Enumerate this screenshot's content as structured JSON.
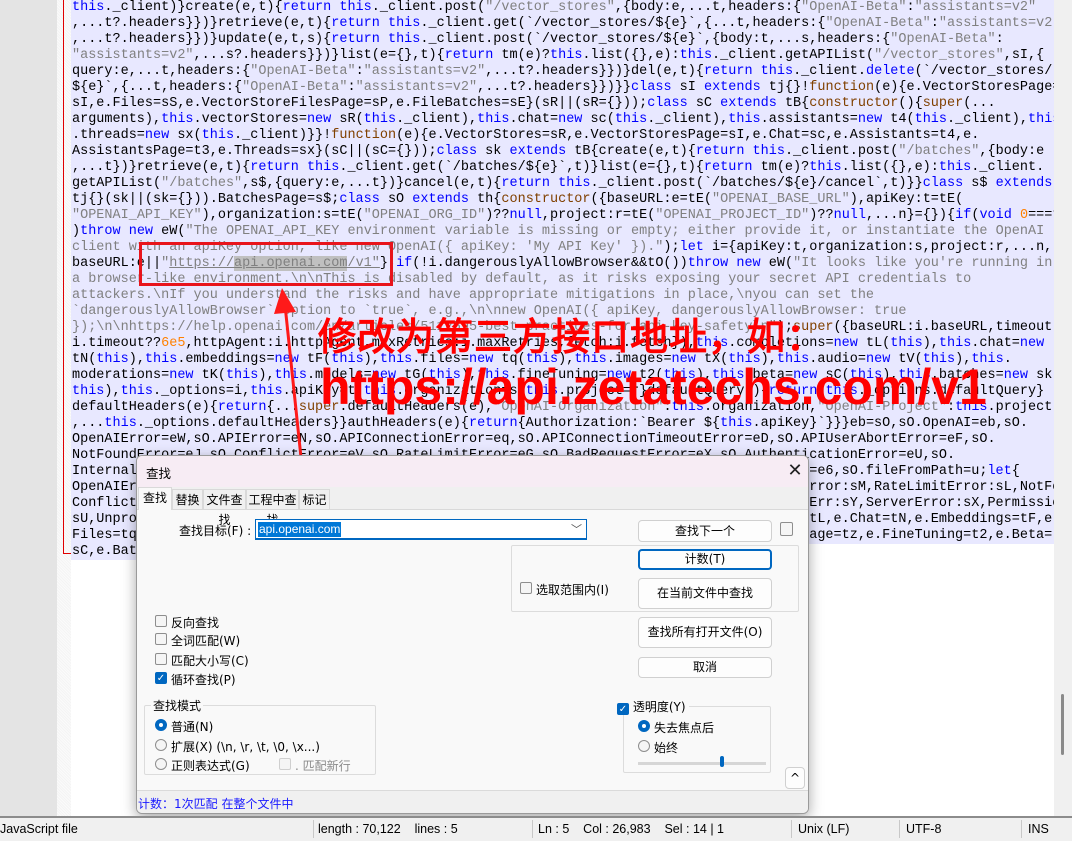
{
  "editor": {
    "lines": [
      "this._client)}create(e,t){return this._client.post(\"/vector_stores\",{body:e,...t,headers:{\"OpenAI-Beta\":\"assistants=v2\"",
      ",...t?.headers}})}retrieve(e,t){return this._client.get(`/vector_stores/${e}`,{...t,headers:{\"OpenAI-Beta\":\"assistants=v2\"",
      ",...t?.headers}})}update(e,t,s){return this._client.post(`/vector_stores/${e}`,{body:t,...s,headers:{\"OpenAI-Beta\":",
      "\"assistants=v2\",...s?.headers}})}list(e={},t){return tm(e)?this.list({},e):this._client.getAPIList(\"/vector_stores\",sI,{",
      "query:e,...t,headers:{\"OpenAI-Beta\":\"assistants=v2\",...t?.headers}})}del(e,t){return this._client.delete(`/vector_stores/",
      "${e}`,{...t,headers:{\"OpenAI-Beta\":\"assistants=v2\",...t?.headers}})}}class sI extends tj{}!function(e){e.VectorStoresPage=",
      "sI,e.Files=sS,e.VectorStoreFilesPage=sP,e.FileBatches=sE}(sR||(sR={}));class sC extends tB{constructor(){super(...",
      "arguments),this.vectorStores=new sR(this._client),this.chat=new sc(this._client),this.assistants=new t4(this._client),this",
      ".threads=new sx(this._client)}}!function(e){e.VectorStores=sR,e.VectorStoresPage=sI,e.Chat=sc,e.Assistants=t4,e.",
      "AssistantsPage=t3,e.Threads=sx}(sC||(sC={}));class sk extends tB{create(e,t){return this._client.post(\"/batches\",{body:e",
      ",...t})}retrieve(e,t){return this._client.get(`/batches/${e}`,t)}list(e={},t){return tm(e)?this.list({},e):this._client.",
      "getAPIList(\"/batches\",s$,{query:e,...t})}cancel(e,t){return this._client.post(`/batches/${e}/cancel`,t)}}class s$ extends",
      "tj{}(sk||(sk={})).BatchesPage=s$;class sO extends th{constructor({baseURL:e=tE(\"OPENAI_BASE_URL\"),apiKey:t=tE(",
      "\"OPENAI_API_KEY\"),organization:s=tE(\"OPENAI_ORG_ID\")??null,project:r=tE(\"OPENAI_PROJECT_ID\")??null,...n}={}){if(void 0===t",
      ")throw new eW(\"The OPENAI_API_KEY environment variable is missing or empty; either provide it, or instantiate the OpenAI",
      "client with an apiKey option, like new OpenAI({ apiKey: 'My API Key' }).\");let i={apiKey:t,organization:s,project:r,...n,",
      "baseURL:e||\"https://api.openai.com/v1\"};if(!i.dangerouslyAllowBrowser&&tO())throw new eW(\"It looks like you're running in",
      "a browser-like environment.\\n\\nThis is disabled by default, as it risks exposing your secret API credentials to",
      "attackers.\\nIf you understand the risks and have appropriate mitigations in place,\\nyou can set the",
      "`dangerouslyAllowBrowser` option to `true`, e.g.,\\n\\nnew OpenAI({ apiKey, dangerouslyAllowBrowser: true",
      "});\\n\\nhttps://help.openai.com/en/articles/5112595-best-practices-for-api-key-safety\\n\");super({baseURL:i.baseURL,timeout:",
      "i.timeout??6e5,httpAgent:i.httpAgent,maxRetries:i.maxRetries,fetch:i.fetch}),this.completions=new tL(this),this.chat=new",
      "tN(this),this.embeddings=new tF(this),this.files=new tq(this),this.images=new tX(this),this.audio=new tV(this),this.",
      "moderations=new tK(this),this.models=new tG(this),this.fineTuning=new t2(this),this.beta=new sC(this),this.batches=new sk(",
      "this),this._options=i,this.apiKey=t,this.organization=s,this.project=r}defaultQuery(){return this._options.defaultQuery}",
      "defaultHeaders(e){return{...super.defaultHeaders(e),\"OpenAI-Organization\":this.organization,\"OpenAI-Project\":this.project",
      ",...this._options.defaultHeaders}}authHeaders(e){return{Authorization:`Bearer ${this.apiKey}`}}}eb=sO,sO.OpenAI=eb,sO.",
      "OpenAIError=eW,sO.APIError=eN,sO.APIConnectionError=eq,sO.APIConnectionTimeoutError=eD,sO.APIUserAbortError=eF,sO.",
      "NotFoundError=eJ,sO.ConflictError=eV,sO.RateLimitError=eG,sO.BadRequestError=eX,sO.AuthenticationError=eU,sO.",
      "InternalServerError=e0,sO.PermissionDeniedError=eK,sO.UnprocessableEntityError=eZ,sO.toFile=e6,sO.fileFromPath=u;let{",
      "OpenAIError:sN,APIError:sA,APIConnectionError:sT,APIConnectionTimeoutError:sj,APIUserAbortError:sM,RateLimitError:sL,NotFoundError:sW,",
      "ConflictError:sD,InternalServerError:sq,AuthenticationError:sF,BadRequestError:sB,RateLimitErr:sY,ServerError:sX,PermissionDeniedError:",
      "sU,UnprocessableEntityError:sZ}=sO;!function(e){e.toFile=e6,e.fileFromPath=u,e.Completions=tL,e.Chat=tN,e.Embeddings=tF,e.",
      "Files=tq,e.FileObjectsPage=tI,e.Images=tX,e.Audio=tV,e.Moderations=tK,e.Models=tG,e.ModelsPage=tz,e.FineTuning=t2,e.Beta=",
      "sC,e.Batches=sk"
    ],
    "search_hit": "api.openai.com",
    "colors": {
      "keyword": "#0000ff",
      "string": "#808080",
      "number": "#ff8000",
      "selection": "#e8e8ff",
      "hit": "#c0c0c0"
    }
  },
  "annotation": {
    "text_line1": "修改为第三方接口地址，如：",
    "text_line2": "https://api.zetatechs.com/v1",
    "color": "#ff0000"
  },
  "find_dialog": {
    "title": "查找",
    "close_icon": "close-icon",
    "tabs": [
      {
        "label": "查找",
        "active": true
      },
      {
        "label": "替换",
        "active": false
      },
      {
        "label": "文件查找",
        "active": false
      },
      {
        "label": "工程中查找",
        "active": false
      },
      {
        "label": "标记",
        "active": false
      }
    ],
    "find_label": "查找目标(F) :",
    "find_value": "api.openai.com",
    "buttons": {
      "find_next": "查找下一个",
      "count": "计数(T)",
      "find_in_current": "在当前文件中查找",
      "find_in_all_open": "查找所有打开文件(O)",
      "cancel": "取消",
      "collapse": "^"
    },
    "in_selection": {
      "label": "选取范围内(I)",
      "checked": false
    },
    "options": [
      {
        "label": "反向查找",
        "checked": false
      },
      {
        "label": "全词匹配(W)",
        "checked": false
      },
      {
        "label": "匹配大小写(C)",
        "checked": false
      },
      {
        "label": "循环查找(P)",
        "checked": true
      }
    ],
    "search_mode": {
      "legend": "查找模式",
      "options": [
        {
          "label": "普通(N)",
          "selected": true
        },
        {
          "label": "扩展(X) (\\n, \\r, \\t, \\0, \\x...)",
          "selected": false
        },
        {
          "label": "正则表达式(G)",
          "selected": false
        }
      ],
      "dot_matches_newline": {
        "label": ". 匹配新行",
        "checked": false,
        "disabled": true
      }
    },
    "transparency": {
      "label": "透明度(Y)",
      "checked": true,
      "options": [
        {
          "label": "失去焦点后",
          "selected": true
        },
        {
          "label": "始终",
          "selected": false
        }
      ],
      "level_percent": 65
    },
    "status": "计数：1次匹配 在整个文件中"
  },
  "statusbar": {
    "file_type": "JavaScript file",
    "length_lines": "length : 70,122    lines : 5",
    "position": "Ln : 5    Col : 26,983    Sel : 14 | 1",
    "eol": "Unix (LF)",
    "encoding": "UTF-8",
    "mode": "INS"
  }
}
